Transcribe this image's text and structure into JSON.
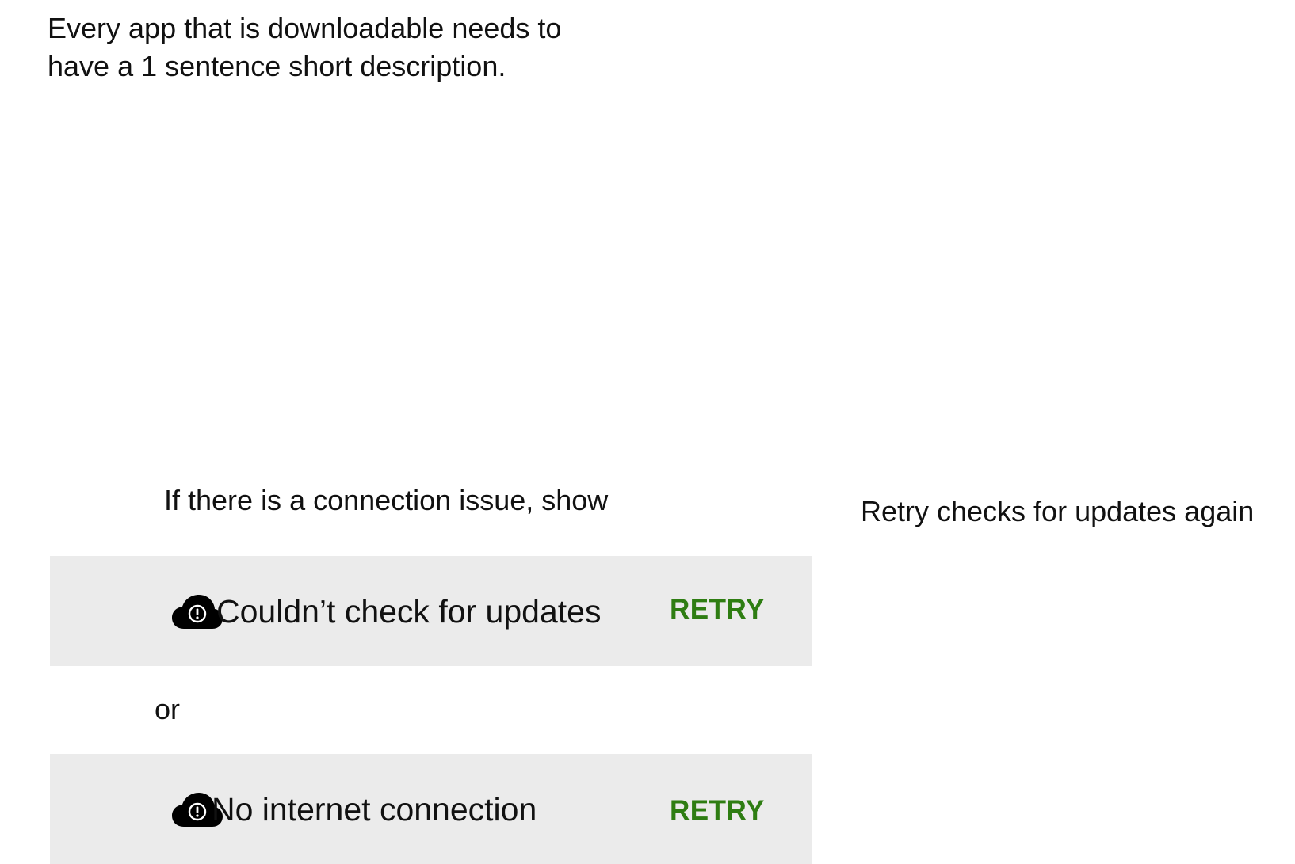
{
  "intro": {
    "line1": "Every app that is downloadable needs to",
    "line2": "have a 1 sentence short description."
  },
  "connection_note": "If there is a connection issue, show",
  "retry_note": "Retry checks for updates again",
  "separator": "or",
  "banners": [
    {
      "icon": "cloud-alert-icon",
      "message": "Couldn’t check for updates",
      "action": "RETRY"
    },
    {
      "icon": "cloud-alert-icon",
      "message": "No internet connection",
      "action": "RETRY"
    }
  ],
  "colors": {
    "banner_background": "#ebebeb",
    "action_text": "#2e7d12",
    "body_text": "#111111",
    "icon": "#000000"
  }
}
